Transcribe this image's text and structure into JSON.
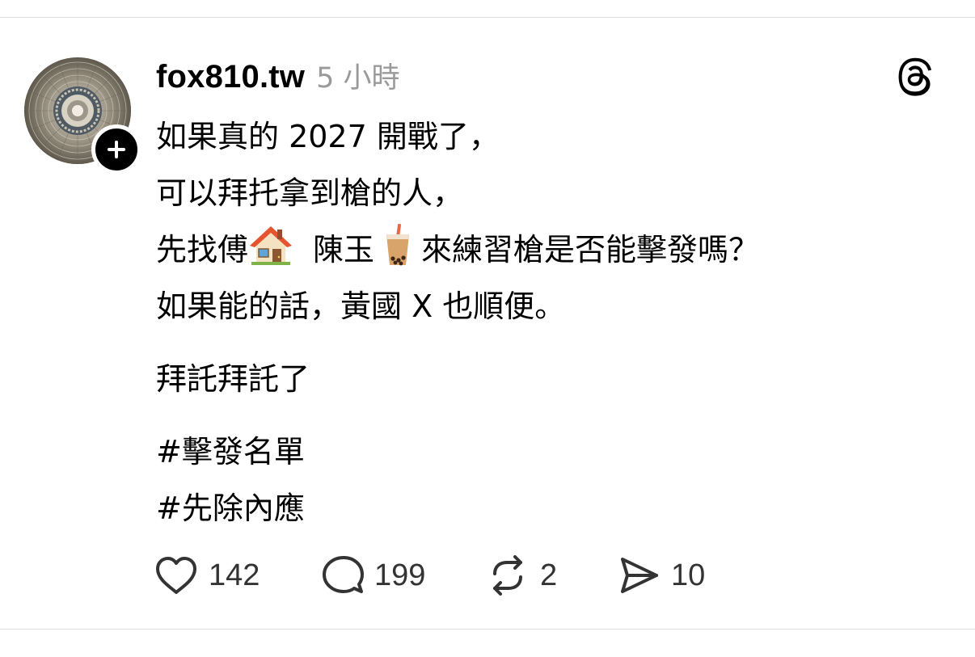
{
  "post": {
    "username": "fox810.tw",
    "timestamp": "5 小時",
    "lines": [
      "如果真的 2027 開戰了，",
      "可以拜托拿到槍的人，"
    ],
    "line3": {
      "part1": "先找傅",
      "emoji1": "house-emoji",
      "part2": "陳玉",
      "emoji2": "bubble-tea-emoji",
      "part3": "來練習槍是否能擊發嗎？"
    },
    "line4": "如果能的話，黃國 X 也順便。",
    "line5": "拜託拜託了",
    "hashtags": [
      "#擊發名單",
      "#先除內應"
    ],
    "actions": {
      "likes": "142",
      "replies": "199",
      "reposts": "2",
      "shares": "10"
    },
    "icons": {
      "like": "heart-icon",
      "reply": "comment-bubble-icon",
      "repost": "repost-icon",
      "share": "send-icon",
      "brand": "threads-logo-icon",
      "follow": "plus-icon"
    },
    "colors": {
      "text": "#000000",
      "muted": "#9a9a9a",
      "icon": "#333333",
      "divider": "#dcdcdc"
    }
  }
}
